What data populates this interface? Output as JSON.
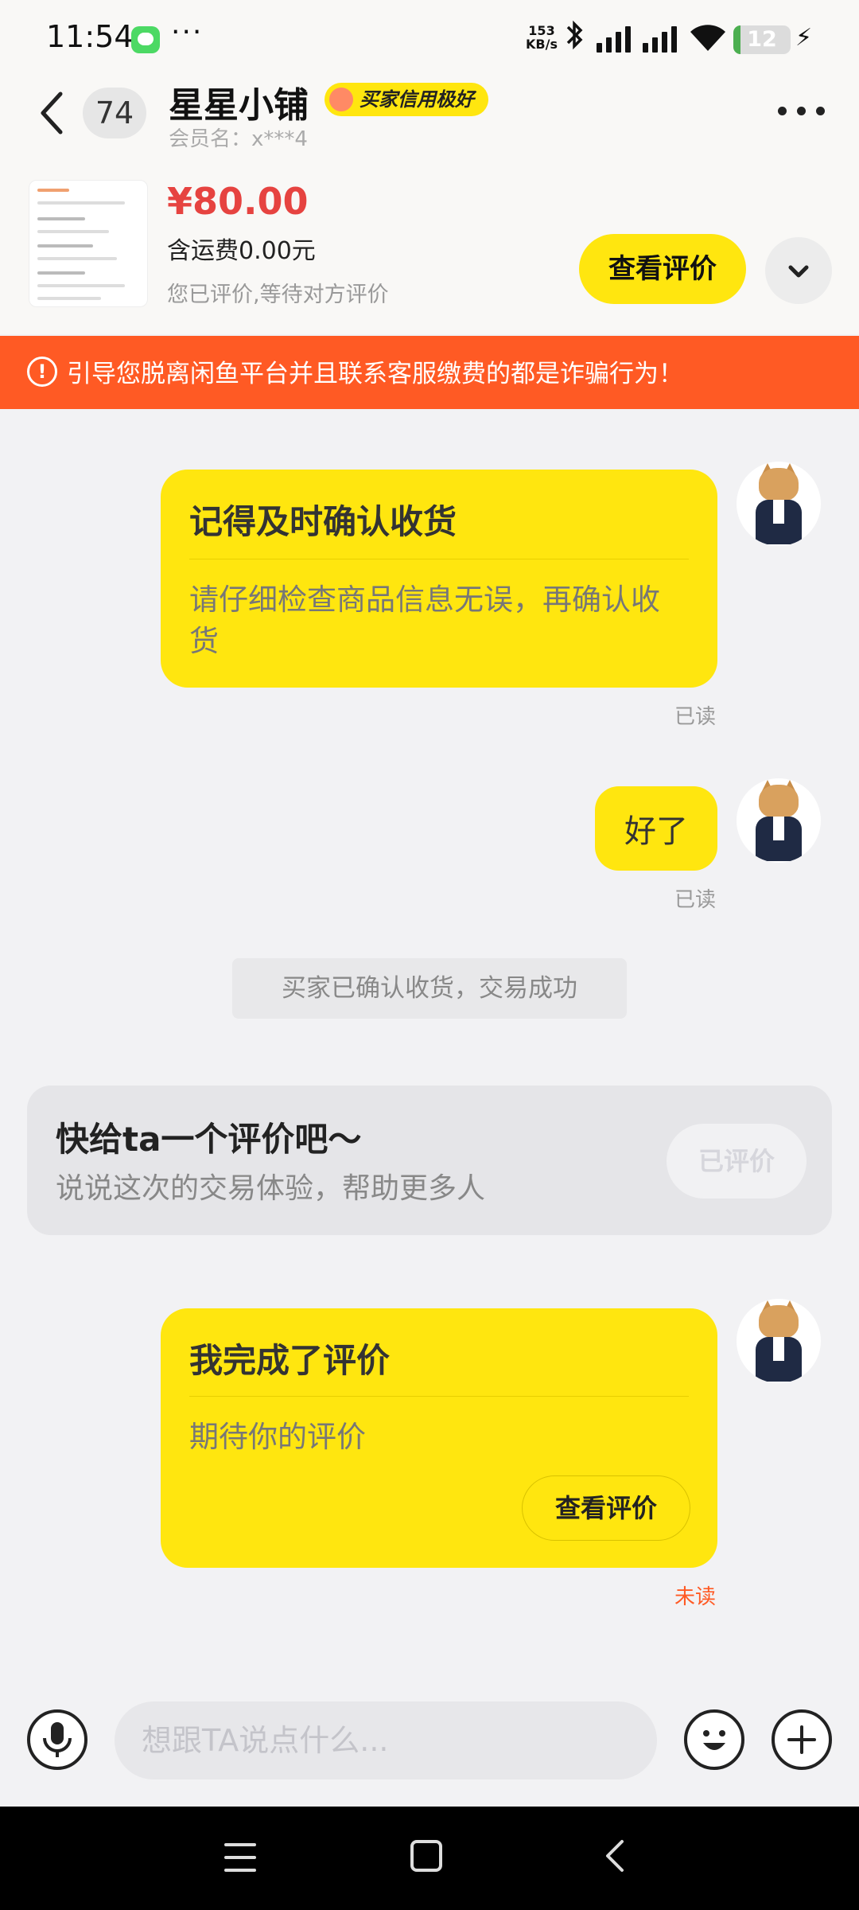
{
  "status_bar": {
    "time": "11:54",
    "dots": "···",
    "net_speed_value": "153",
    "net_speed_unit": "KB/s",
    "battery_level": "12",
    "battery_fraction": 0.12
  },
  "header": {
    "unread_count": "74",
    "shop_name": "星星小铺",
    "credit_badge": "买家信用极好",
    "member_name": "会员名：x***4"
  },
  "product": {
    "price": "¥80.00",
    "shipping": "含运费0.00元",
    "review_status": "您已评价,等待对方评价",
    "view_review_button": "查看评价"
  },
  "warning": {
    "icon": "!",
    "text": "引导您脱离闲鱼平台并且联系客服缴费的都是诈骗行为！"
  },
  "messages": [
    {
      "title": "记得及时确认收货",
      "body": "请仔细检查商品信息无误，再确认收货",
      "status": "已读"
    },
    {
      "text": "好了",
      "status": "已读"
    },
    {
      "system": "买家已确认收货，交易成功"
    },
    {
      "title": "我完成了评价",
      "body": "期待你的评价",
      "button": "查看评价",
      "status": "未读"
    }
  ],
  "review_card": {
    "title": "快给ta一个评价吧～",
    "subtitle": "说说这次的交易体验，帮助更多人",
    "button": "已评价"
  },
  "input": {
    "placeholder": "想跟TA说点什么..."
  },
  "colors": {
    "accent": "#ffe60f",
    "warning": "#ff5a24",
    "price": "#e64340",
    "unread": "#ff5a24"
  },
  "icons": [
    "back-arrow-icon",
    "more-icon",
    "chevron-down-icon",
    "warning-icon",
    "microphone-icon",
    "emoji-icon",
    "plus-icon",
    "menu-icon",
    "home-icon",
    "nav-back-icon"
  ]
}
